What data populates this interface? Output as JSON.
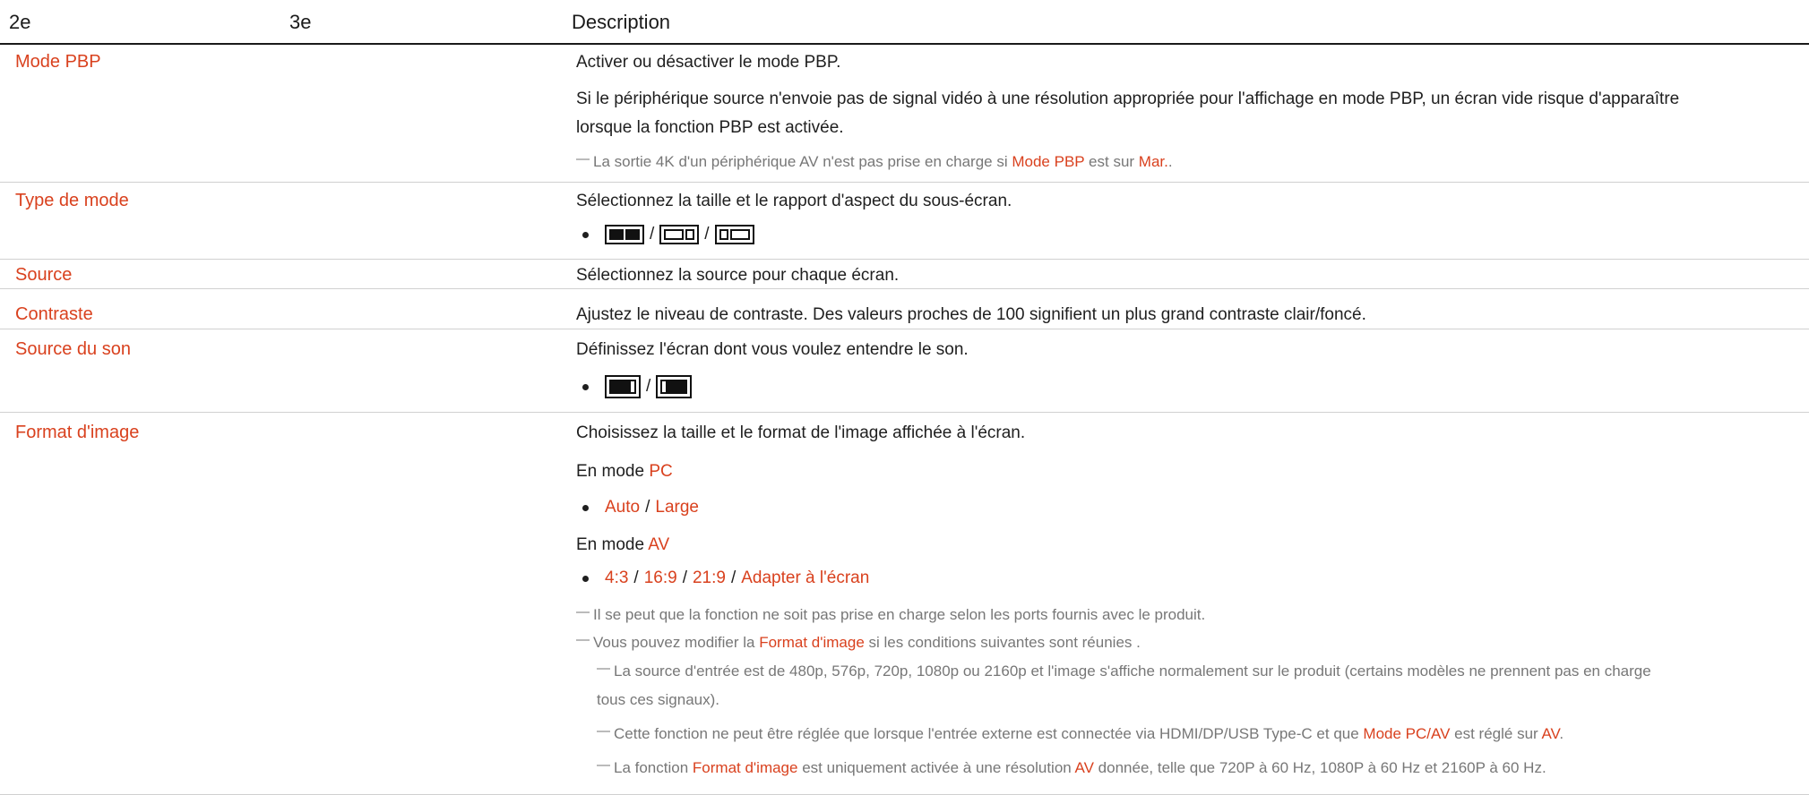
{
  "header": {
    "col1": "2e",
    "col2": "3e",
    "col3": "Description"
  },
  "rows": {
    "mode_pbp": {
      "title": "Mode PBP",
      "line1": "Activer ou désactiver le mode PBP.",
      "line2": "Si le périphérique source n'envoie pas de signal vidéo à une résolution appropriée pour l'affichage en mode PBP, un écran vide risque d'apparaître",
      "line3": "lorsque la fonction PBP est activée.",
      "note": {
        "dash": "―",
        "t1": "La sortie 4K d'un périphérique AV n'est pas prise en charge si ",
        "h1": "Mode PBP",
        "t2": " est sur ",
        "h2": "Mar.",
        "t3": "."
      }
    },
    "type_mode": {
      "title": "Type de mode",
      "line1": "Sélectionnez la taille et le rapport d'aspect du sous-écran.",
      "sep": "/",
      "icons": [
        "pbp-equal-split-icon",
        "pbp-wide-narrow-icon",
        "pbp-narrow-wide-icon"
      ]
    },
    "source": {
      "title": "Source",
      "line1": "Sélectionnez la source pour chaque écran."
    },
    "contraste": {
      "title": "Contraste",
      "line1": "Ajustez le niveau de contraste. Des valeurs proches de 100 signifient un plus grand contraste clair/foncé."
    },
    "source_son": {
      "title": "Source du son",
      "line1": "Définissez l'écran dont vous voulez entendre le son.",
      "sep": "/",
      "icons": [
        "sound-left-screen-icon",
        "sound-right-screen-icon"
      ]
    },
    "format_image": {
      "title": "Format d'image",
      "line1": "Choisissez la taille et le format de l'image affichée à l'écran.",
      "pc_prefix": "En mode ",
      "pc_label": "PC",
      "pc_options": [
        "Auto",
        "Large"
      ],
      "av_prefix": "En mode ",
      "av_label": "AV",
      "av_options": [
        "4:3",
        "16:9",
        "21:9",
        "Adapter à l'écran"
      ],
      "sep": "/",
      "note1": "Il se peut que la fonction ne soit pas prise en charge selon les ports fournis avec le produit.",
      "note2": {
        "t1": "Vous pouvez modifier la ",
        "h1": "Format d'image",
        "t2": " si les conditions suivantes sont réunies ."
      },
      "sub1_a": "La source d'entrée est de 480p, 576p, 720p, 1080p ou 2160p et l'image s'affiche normalement sur le produit (certains modèles ne prennent pas en charge",
      "sub1_b": "tous ces signaux).",
      "sub2": {
        "t1": "Cette fonction ne peut être réglée que lorsque l'entrée externe est connectée via HDMI/DP/USB Type-C et que ",
        "h1": "Mode PC/AV",
        "t2": " est réglé sur ",
        "h2": "AV",
        "t3": "."
      },
      "sub3": {
        "t1": "La fonction ",
        "h1": "Format d'image",
        "t2": " est uniquement activée à une résolution ",
        "h2": "AV",
        "t3": " donnée, telle que 720P à 60 Hz, 1080P à 60 Hz et 2160P à 60 Hz."
      }
    }
  },
  "colors": {
    "accent": "#d9411e",
    "text": "#1f1f1f",
    "note": "#777777",
    "rule": "#d0d0d0"
  }
}
